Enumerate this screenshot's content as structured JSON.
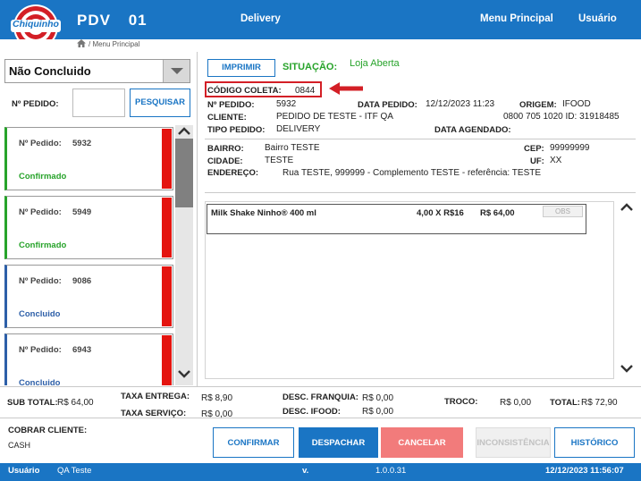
{
  "header": {
    "logo_text": "Chiquinho",
    "title": "PDV",
    "terminal": "01",
    "nav_delivery": "Delivery",
    "nav_menu": "Menu Principal",
    "nav_user": "Usuário",
    "brand_color": "#1a75c4"
  },
  "breadcrumb": "/ Menu Principal",
  "left": {
    "status_filter": "Não Concluido",
    "order_label": "Nº PEDIDO:",
    "order_value": "",
    "search_label": "PESQUISAR",
    "orders": [
      {
        "label": "Nº Pedido:",
        "number": "5932",
        "status": "Confirmado",
        "color": "#27a32a"
      },
      {
        "label": "Nº Pedido:",
        "number": "5949",
        "status": "Confirmado",
        "color": "#27a32a"
      },
      {
        "label": "Nº Pedido:",
        "number": "9086",
        "status": "Concluido",
        "color": "#2d5fa8"
      },
      {
        "label": "Nº Pedido:",
        "number": "6943",
        "status": "Concluido",
        "color": "#2d5fa8"
      }
    ]
  },
  "detail": {
    "print_label": "IMPRIMIR",
    "situacao_label": "SITUAÇÃO:",
    "situacao_value": "Loja Aberta",
    "coleta_label": "CÓDIGO COLETA:",
    "coleta_value": "0844",
    "pedido_label": "Nº PEDIDO:",
    "pedido_value": "5932",
    "data_pedido_label": "DATA PEDIDO:",
    "data_pedido_value": "12/12/2023 11:23",
    "origem_label": "ORIGEM:",
    "origem_value": "IFOOD",
    "cliente_label": "CLIENTE:",
    "cliente_value": "PEDIDO DE TESTE - ITF QA",
    "phone_value": "0800 705 1020 ID: 31918485",
    "tipo_label": "TIPO PEDIDO:",
    "tipo_value": "DELIVERY",
    "agendado_label": "DATA AGENDADO:",
    "bairro_label": "BAIRRO:",
    "bairro_value": "Bairro TESTE",
    "cep_label": "CEP:",
    "cep_value": "99999999",
    "cidade_label": "CIDADE:",
    "cidade_value": "TESTE",
    "uf_label": "UF:",
    "uf_value": "XX",
    "endereco_label": "ENDEREÇO:",
    "endereco_value": "Rua TESTE, 999999 - Complemento TESTE - referência: TESTE"
  },
  "items": [
    {
      "name": "Milk Shake Ninho® 400 ml",
      "qty": "4,00 X R$16",
      "total": "R$ 64,00",
      "obs": "OBS"
    }
  ],
  "totals": {
    "subtotal_label": "SUB TOTAL:",
    "subtotal_value": "R$ 64,00",
    "taxa_entrega_label": "TAXA ENTREGA:",
    "taxa_entrega_value": "R$ 8,90",
    "taxa_servico_label": "TAXA SERVIÇO:",
    "taxa_servico_value": "R$ 0,00",
    "desc_franquia_label": "DESC. FRANQUIA:",
    "desc_franquia_value": "R$ 0,00",
    "desc_ifood_label": "DESC. IFOOD:",
    "desc_ifood_value": "R$ 0,00",
    "troco_label": "TROCO:",
    "troco_value": "R$ 0,00",
    "total_label": "TOTAL:",
    "total_value": "R$ 72,90"
  },
  "actions": {
    "cobrar_label": "COBRAR CLIENTE:",
    "cobrar_value": "CASH",
    "confirmar": "CONFIRMAR",
    "despachar": "DESPACHAR",
    "cancelar": "CANCELAR",
    "inconsistencia": "INCONSISTÊNCIA",
    "historico": "HISTÓRICO"
  },
  "footer": {
    "user_label": "Usuário",
    "user_value": "QA Teste",
    "version_label": "v.",
    "version_value": "1.0.0.31",
    "datetime": "12/12/2023 11:56:07"
  },
  "icons": {
    "home": "home-icon",
    "dropdown": "chevron-down-icon",
    "scroll_up": "chevron-up-icon",
    "scroll_down": "chevron-down-icon",
    "annotation": "red-arrow-icon"
  }
}
